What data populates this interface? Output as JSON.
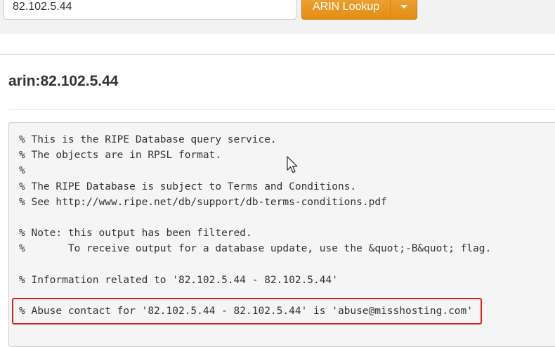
{
  "search": {
    "ip_value": "82.102.5.44",
    "lookup_label": "ARIN Lookup"
  },
  "result": {
    "title": "arin:82.102.5.44",
    "lines": [
      "% This is the RIPE Database query service.",
      "% The objects are in RPSL format.",
      "%",
      "% The RIPE Database is subject to Terms and Conditions.",
      "% See http://www.ripe.net/db/support/db-terms-conditions.pdf",
      "",
      "% Note: this output has been filtered.",
      "%       To receive output for a database update, use the &quot;-B&quot; flag.",
      "",
      "% Information related to '82.102.5.44 - 82.102.5.44'",
      "",
      "% Abuse contact for '82.102.5.44 - 82.102.5.44' is 'abuse@misshosting.com'"
    ]
  },
  "colors": {
    "accent": "#e9961f",
    "highlight": "#e02020"
  },
  "icons": {
    "dropdown": "caret-down-icon",
    "pointer": "mouse-cursor-icon"
  }
}
